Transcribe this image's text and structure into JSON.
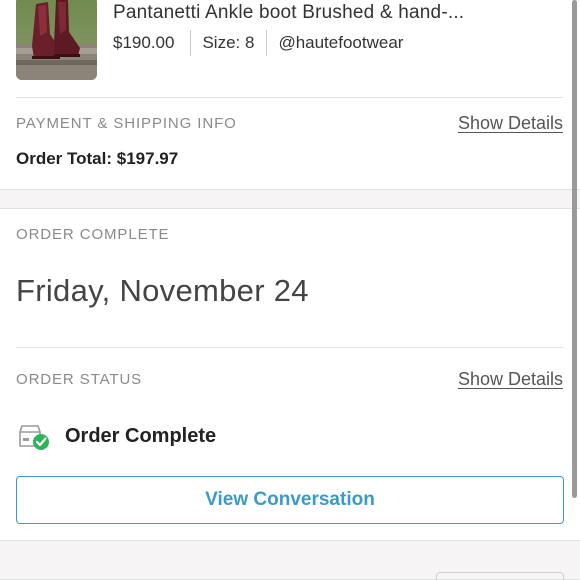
{
  "product": {
    "title": "Pantanetti Ankle boot Brushed & hand-...",
    "price": "$190.00",
    "size": "Size: 8",
    "seller": "@hautefootwear",
    "thumbnail_icon": "boot-photo"
  },
  "payment": {
    "label": "PAYMENT & SHIPPING INFO",
    "show_details": "Show Details",
    "order_total": "Order Total: $197.97"
  },
  "completion": {
    "label": "ORDER COMPLETE",
    "date": "Friday, November 24"
  },
  "status": {
    "label": "ORDER STATUS",
    "show_details": "Show Details",
    "icon": "package-check-icon",
    "text": "Order Complete"
  },
  "actions": {
    "view_conversation": "View Conversation"
  },
  "colors": {
    "accent": "#3a9bc8",
    "success": "#2fb35a",
    "section_label": "#8a8a8a",
    "band": "#f6f4f4"
  }
}
